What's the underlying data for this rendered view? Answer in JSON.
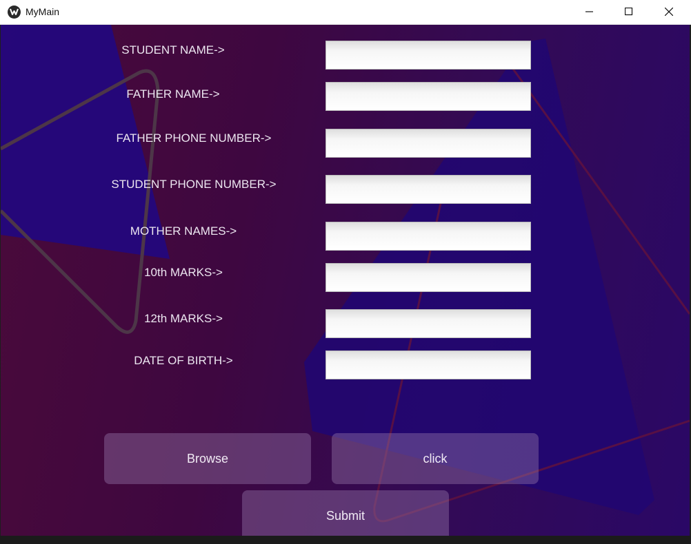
{
  "window": {
    "title": "MyMain",
    "icon": "kivy-icon"
  },
  "colors": {
    "background_left": "#4a0a3a",
    "background_right": "#2a0866",
    "accent_shape": "#23087a",
    "button_fill": "rgba(150,120,170,0.42)"
  },
  "form": {
    "fields": [
      {
        "label": "STUDENT NAME->",
        "value": ""
      },
      {
        "label": "FATHER NAME->",
        "value": ""
      },
      {
        "label": "FATHER PHONE NUMBER->",
        "value": ""
      },
      {
        "label": "STUDENT PHONE NUMBER->",
        "value": ""
      },
      {
        "label": "MOTHER NAMES->",
        "value": ""
      },
      {
        "label": "10th MARKS->",
        "value": ""
      },
      {
        "label": "12th MARKS->",
        "value": ""
      },
      {
        "label": "DATE OF BIRTH->",
        "value": ""
      }
    ]
  },
  "buttons": {
    "browse": "Browse",
    "click": "click",
    "submit": "Submit"
  }
}
